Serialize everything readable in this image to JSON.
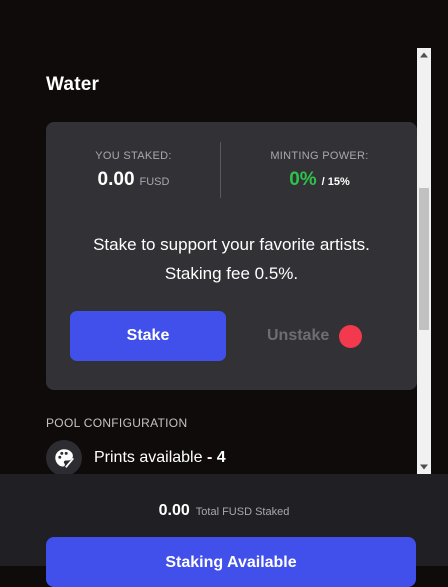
{
  "pool": {
    "title": "Water"
  },
  "stake_card": {
    "you_staked_label": "YOU STAKED:",
    "you_staked_value": "0.00",
    "you_staked_unit": "FUSD",
    "minting_power_label": "MINTING POWER:",
    "minting_power_value": "0%",
    "minting_power_max": "/ 15%",
    "message_line1": "Stake to support your favorite artists.",
    "message_line2": "Staking fee 0.5%.",
    "stake_button": "Stake",
    "unstake_button": "Unstake",
    "status_color": "#f2394d"
  },
  "pool_config": {
    "heading": "POOL CONFIGURATION",
    "prints_label": "Prints available",
    "prints_value": "- 4",
    "icon": "palette-icon"
  },
  "footer": {
    "total_value": "0.00",
    "total_label": "Total FUSD Staked",
    "staking_button": "Staking Available"
  },
  "colors": {
    "accent": "#4250eb",
    "positive": "#2ec24a",
    "card": "#323236",
    "background": "#0f0b0a"
  }
}
